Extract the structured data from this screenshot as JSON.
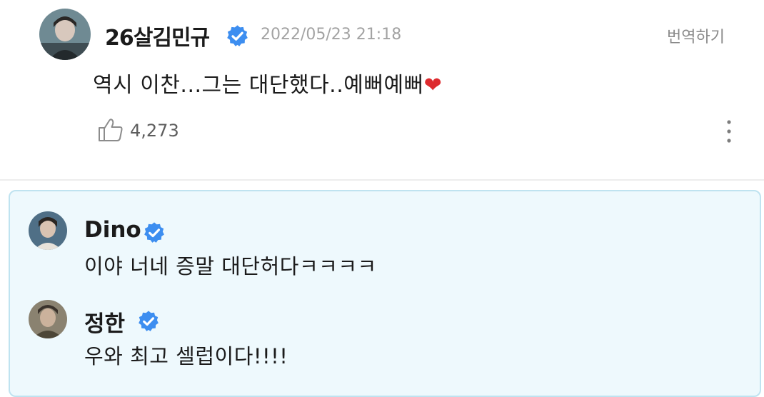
{
  "post": {
    "author": "26살김민규",
    "timestamp": "2022/05/23 21:18",
    "translate_label": "번역하기",
    "message": "역시 이찬...그는 대단했다..예뻐예뻐",
    "heart_emoji": "❤",
    "likes": "4,273",
    "avatar_icon": "user-photo-avatar",
    "verified_icon": "verified-check-badge"
  },
  "replies": [
    {
      "author": "Dino",
      "text": "이야 너네 증말 대단허다ㅋㅋㅋㅋ"
    },
    {
      "author": "정한",
      "text": "우와 최고 셀럽이다!!!!"
    }
  ],
  "colors": {
    "verified_badge": "#3d8ef0",
    "reply_box_bg": "#eef9fd",
    "reply_box_border": "#bfe3f0",
    "timestamp": "#a3a3a3",
    "heart": "#dd2a2e"
  }
}
